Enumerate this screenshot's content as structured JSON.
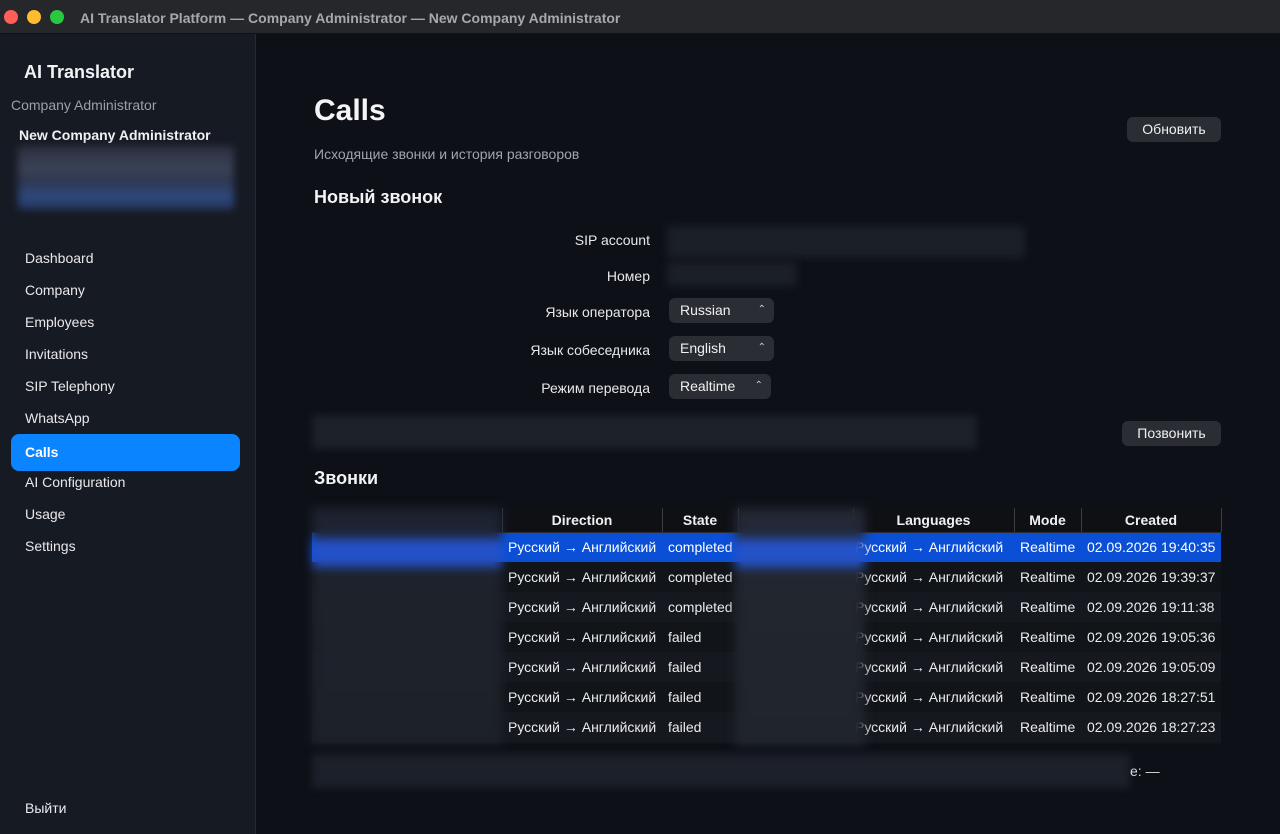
{
  "window": {
    "title": "AI Translator Platform — Company Administrator — New Company Administrator"
  },
  "sidebar": {
    "app_title": "AI Translator",
    "role": "Company Administrator",
    "user_name": "New Company Administrator",
    "items": [
      {
        "label": "Dashboard",
        "active": false
      },
      {
        "label": "Company",
        "active": false
      },
      {
        "label": "Employees",
        "active": false
      },
      {
        "label": "Invitations",
        "active": false
      },
      {
        "label": "SIP  Telephony",
        "active": false
      },
      {
        "label": "WhatsApp",
        "active": false
      },
      {
        "label": "Calls",
        "active": true
      },
      {
        "label": "AI Configuration",
        "active": false
      },
      {
        "label": "Usage",
        "active": false
      },
      {
        "label": "Settings",
        "active": false
      }
    ],
    "logout_label": "Выйти"
  },
  "page": {
    "title": "Calls",
    "subtitle": "Исходящие звонки и история разговоров",
    "refresh_label": "Обновить"
  },
  "new_call": {
    "section_title": "Новый звонок",
    "sip_account_label": "SIP account",
    "number_label": "Номер",
    "operator_language_label": "Язык оператора",
    "operator_language_value": "Russian",
    "interlocutor_language_label": "Язык собеседника",
    "interlocutor_language_value": "English",
    "mode_label": "Режим перевода",
    "mode_value": "Realtime",
    "call_label": "Позвонить"
  },
  "calls": {
    "section_title": "Звонки",
    "columns": [
      "Direction",
      "State",
      "Languages",
      "Mode",
      "Created"
    ],
    "rows": [
      {
        "direction": "Русский → Английский",
        "state": "completed",
        "languages": "Русский → Английский",
        "mode": "Realtime",
        "created": "02.09.2026 19:40:35",
        "selected": true
      },
      {
        "direction": "Русский → Английский",
        "state": "completed",
        "languages": "Русский → Английский",
        "mode": "Realtime",
        "created": "02.09.2026 19:39:37",
        "selected": false
      },
      {
        "direction": "Русский → Английский",
        "state": "completed",
        "languages": "Русский → Английский",
        "mode": "Realtime",
        "created": "02.09.2026 19:11:38",
        "selected": false
      },
      {
        "direction": "Русский → Английский",
        "state": "failed",
        "languages": "Русский → Английский",
        "mode": "Realtime",
        "created": "02.09.2026 19:05:36",
        "selected": false
      },
      {
        "direction": "Русский → Английский",
        "state": "failed",
        "languages": "Русский → Английский",
        "mode": "Realtime",
        "created": "02.09.2026 19:05:09",
        "selected": false
      },
      {
        "direction": "Русский → Английский",
        "state": "failed",
        "languages": "Русский → Английский",
        "mode": "Realtime",
        "created": "02.09.2026 18:27:51",
        "selected": false
      },
      {
        "direction": "Русский → Английский",
        "state": "failed",
        "languages": "Русский → Английский",
        "mode": "Realtime",
        "created": "02.09.2026 18:27:23",
        "selected": false
      }
    ],
    "status_tail": "e: —"
  }
}
